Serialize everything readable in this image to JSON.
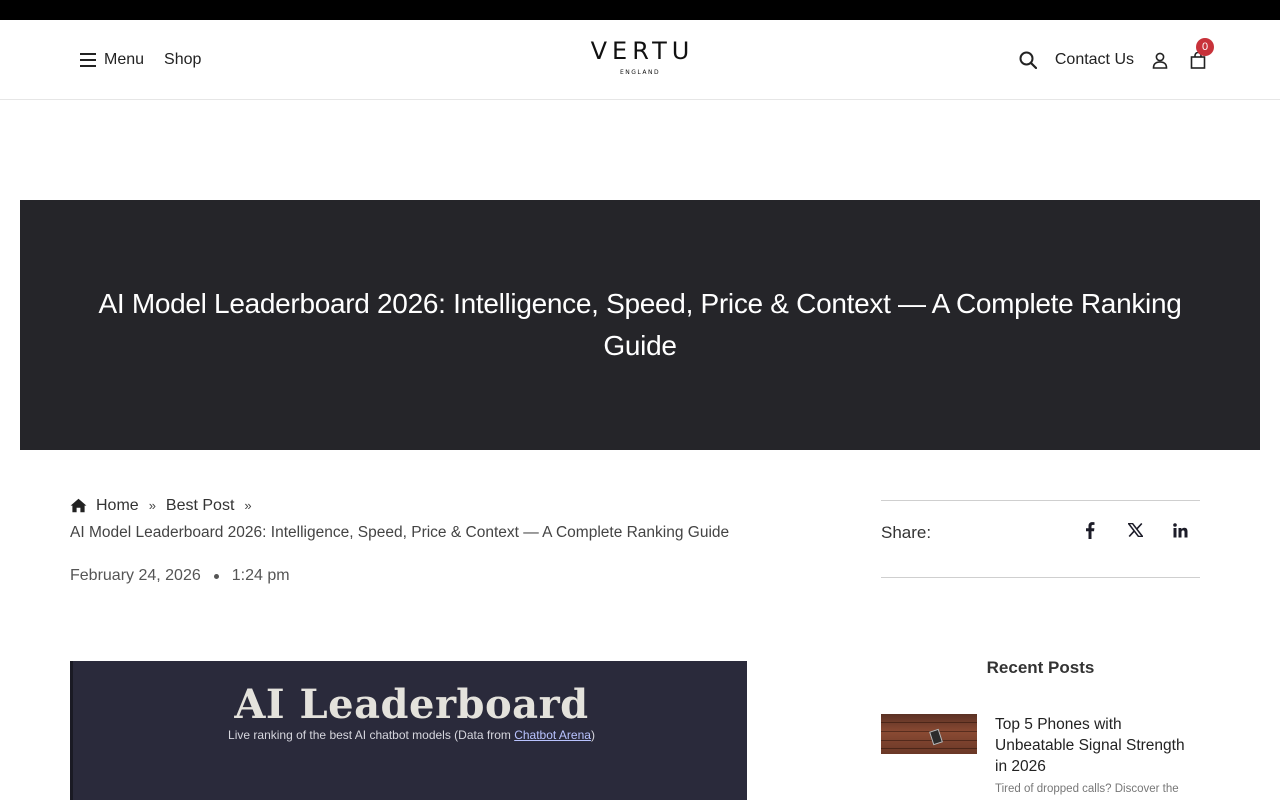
{
  "header": {
    "menu_label": "Menu",
    "shop_label": "Shop",
    "logo_main": "VERTU",
    "logo_sub": "ENGLAND",
    "contact_label": "Contact Us",
    "cart_count": "0"
  },
  "hero": {
    "title": "AI Model Leaderboard 2026: Intelligence, Speed, Price & Context — A Complete Ranking Guide"
  },
  "breadcrumb": {
    "home": "Home",
    "separator": "»",
    "category": "Best Post",
    "current": "AI Model Leaderboard 2026: Intelligence, Speed, Price & Context — A Complete Ranking Guide"
  },
  "post_meta": {
    "date": "February 24, 2026",
    "time": "1:24 pm"
  },
  "featured_image": {
    "title": "AI Leaderboard",
    "subtitle_prefix": "Live ranking of the best AI chatbot models (Data from ",
    "subtitle_link": "Chatbot Arena",
    "subtitle_suffix": ")"
  },
  "share": {
    "label": "Share:",
    "icons": [
      "facebook-icon",
      "x-icon",
      "linkedin-icon"
    ]
  },
  "sidebar": {
    "recent_title": "Recent Posts",
    "recent_posts": [
      {
        "title": "Top 5 Phones with Unbeatable Signal Strength in 2026",
        "excerpt": "Tired of dropped calls? Discover the"
      }
    ]
  },
  "colors": {
    "hero_bg": "#252529",
    "badge": "#c8323a",
    "featured_bg": "#2a2a3b"
  }
}
